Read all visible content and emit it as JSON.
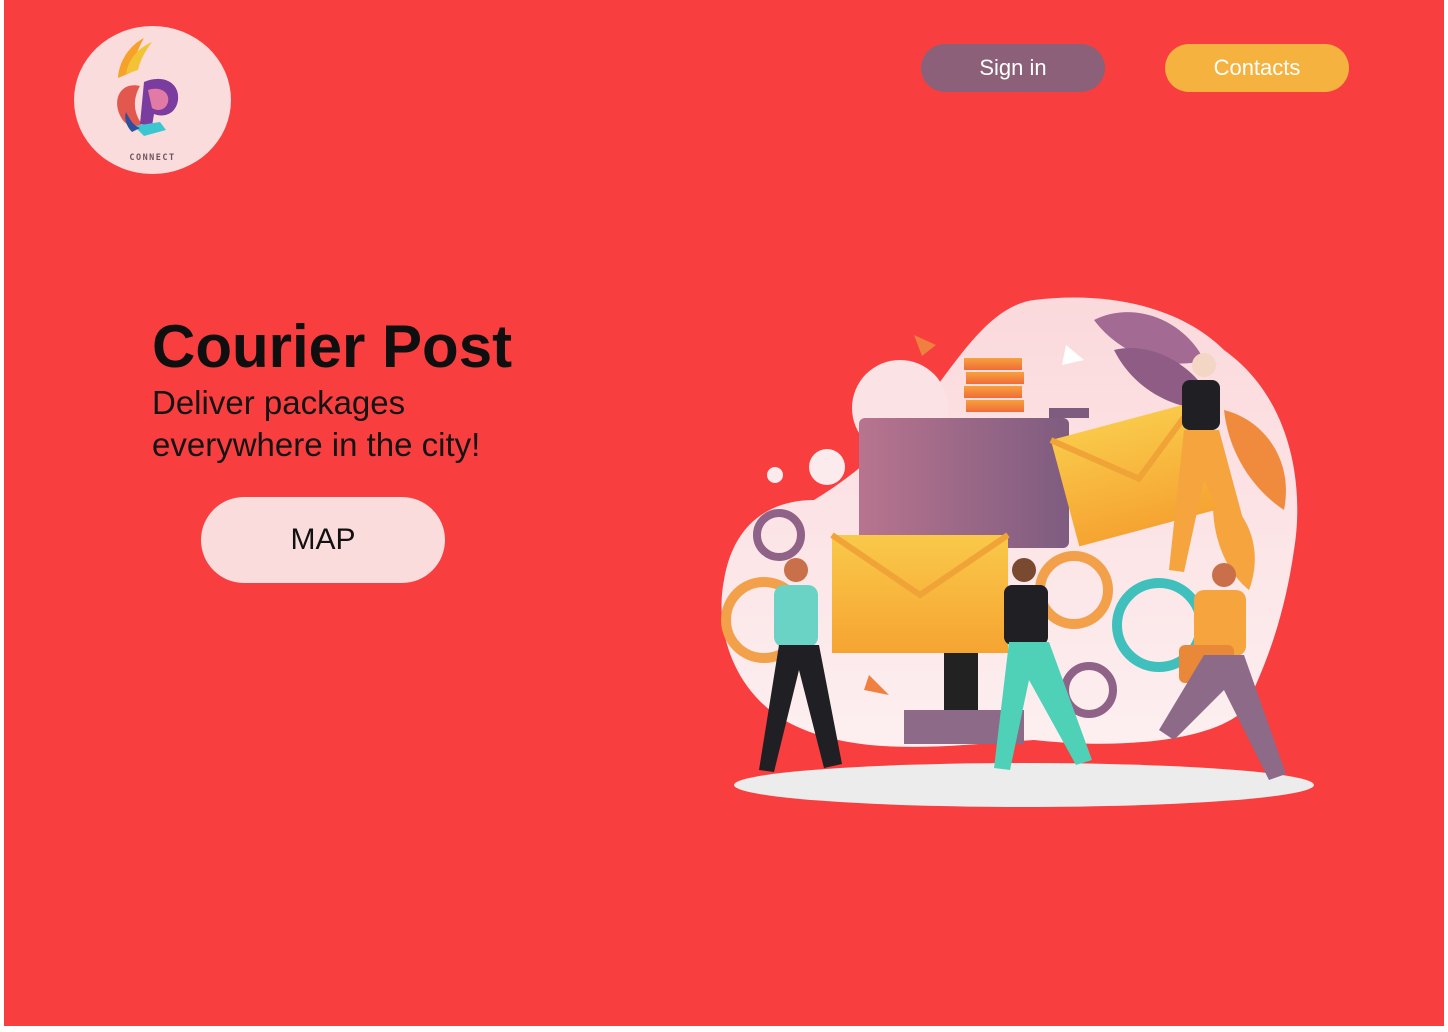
{
  "logo": {
    "text": "CONNECT"
  },
  "nav": {
    "signin_label": "Sign in",
    "contacts_label": "Contacts"
  },
  "hero": {
    "title": "Courier Post",
    "subtitle": "Deliver packages everywhere in the city!",
    "map_label": "MAP"
  },
  "colors": {
    "background": "#f93e3f",
    "signin": "#8c6078",
    "contacts": "#f5b23e",
    "map_button": "#fbdcdc",
    "logo_circle": "#fbdcdc"
  },
  "illustration": {
    "icon": "couriers-carrying-envelopes-illustration"
  }
}
